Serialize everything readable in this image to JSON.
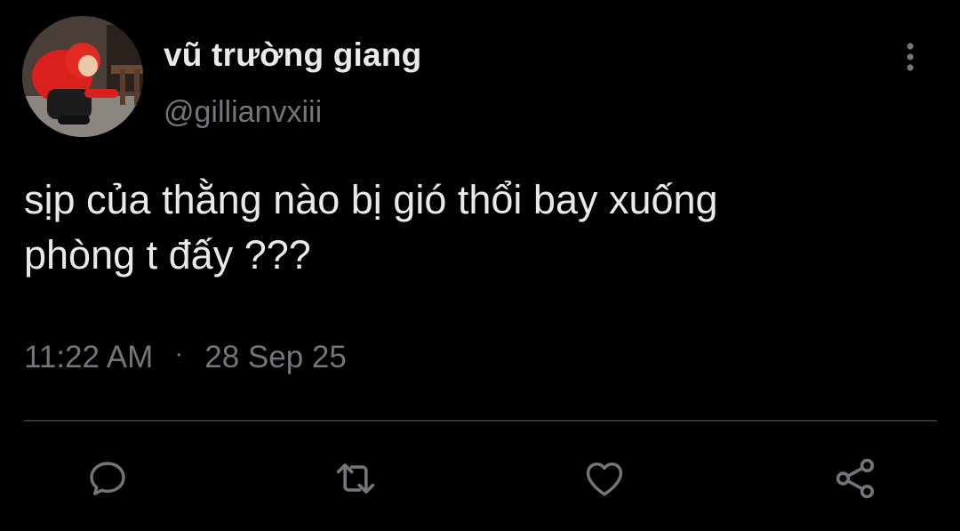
{
  "tweet": {
    "author": {
      "display_name": "vũ trường giang",
      "handle": "@gillianvxiii",
      "avatar_icon": "profile-photo-person-red-hoodie"
    },
    "text": "sịp của thằng nào bị gió thổi bay xuống\nphòng t đấy ???",
    "time": "11:22 AM",
    "separator": "·",
    "date": "28 Sep 25"
  },
  "actions": [
    {
      "name": "reply",
      "icon": "chat-bubble-icon"
    },
    {
      "name": "retweet",
      "icon": "retweet-icon"
    },
    {
      "name": "like",
      "icon": "heart-icon"
    },
    {
      "name": "share",
      "icon": "share-icon"
    }
  ],
  "colors": {
    "background": "#000000",
    "primary_text": "#e7e9ea",
    "secondary_text": "#71767b",
    "divider": "#2f3336"
  }
}
